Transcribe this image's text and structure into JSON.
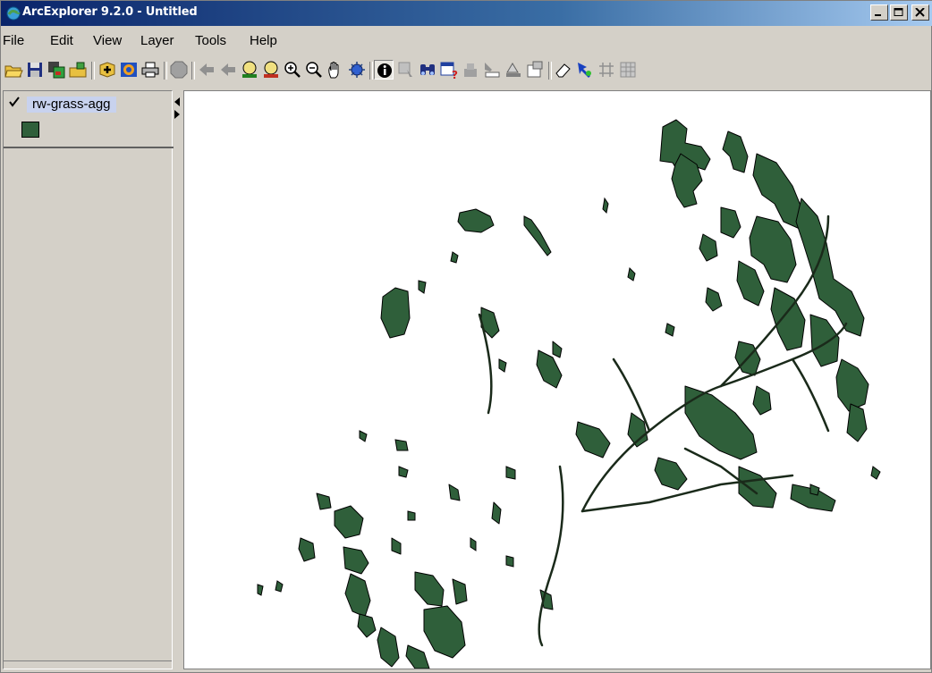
{
  "window": {
    "title": "ArcExplorer 9.2.0 - Untitled",
    "colors": {
      "titlebar": "#0a246a",
      "layer_fill": "#2f5f3a",
      "map_bg": "#ffffff"
    }
  },
  "menu": {
    "items": [
      {
        "label": "File"
      },
      {
        "label": "Edit"
      },
      {
        "label": "View"
      },
      {
        "label": "Layer"
      },
      {
        "label": "Tools"
      },
      {
        "label": "Help"
      }
    ]
  },
  "toolbar": {
    "buttons": [
      {
        "icon": "open-folder-icon"
      },
      {
        "icon": "save-icon"
      },
      {
        "icon": "save-as-icon"
      },
      {
        "icon": "open-map-icon"
      },
      {
        "icon": "add-data-icon"
      },
      {
        "icon": "add-service-icon"
      },
      {
        "icon": "print-icon"
      },
      {
        "icon": "stop-icon"
      },
      {
        "icon": "previous-extent-icon"
      },
      {
        "icon": "next-extent-icon"
      },
      {
        "icon": "full-extent-icon"
      },
      {
        "icon": "layer-extent-icon"
      },
      {
        "icon": "zoom-in-icon"
      },
      {
        "icon": "zoom-out-icon"
      },
      {
        "icon": "pan-icon"
      },
      {
        "icon": "globe-icon"
      },
      {
        "icon": "identify-icon"
      },
      {
        "icon": "select-icon"
      },
      {
        "icon": "find-icon"
      },
      {
        "icon": "query-icon"
      },
      {
        "icon": "measure-icon"
      },
      {
        "icon": "label-icon"
      },
      {
        "icon": "graphics-icon"
      },
      {
        "icon": "properties-icon"
      },
      {
        "icon": "eraser-icon"
      },
      {
        "icon": "hyperlink-icon"
      },
      {
        "icon": "grid-icon"
      },
      {
        "icon": "table-icon"
      }
    ]
  },
  "toc": {
    "layers": [
      {
        "name": "rw-grass-agg",
        "checked": true,
        "fill": "#2f5f3a"
      }
    ]
  }
}
